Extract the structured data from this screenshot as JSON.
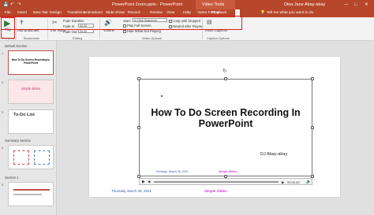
{
  "title_bar": {
    "filename": "PowerPoint Zoom.pptx",
    "app": "PowerPoint",
    "contextual_group": "Video Tools",
    "user": "Dina Jane Abay-abay"
  },
  "tabs": [
    "File",
    "Insert",
    "New Tab",
    "Design",
    "Transitions",
    "Animations",
    "Slide Show",
    "Record",
    "Review",
    "View",
    "Help",
    "Video Format",
    "Playback"
  ],
  "tell_me": "Tell me what you want to do",
  "ribbon": {
    "play_label": "Play",
    "preview_group": "Preview",
    "add_bookmark": "Add Bookmark",
    "remove_bookmark": "Remove Bookmark",
    "bookmarks_group": "Bookmarks",
    "trim_video": "Trim Video",
    "fade_duration": "Fade Duration",
    "fade_in": "Fade In:",
    "fade_in_value": "00.00",
    "fade_out": "Fade Out:",
    "fade_out_value": "00.00",
    "editing_group": "Editing",
    "volume": "Volume",
    "start_label": "Start:",
    "start_value": "In Click Sequence",
    "play_full_screen": "Play Full Screen",
    "hide_not_playing": "Hide While Not Playing",
    "loop": "Loop until Stopped",
    "rewind": "Rewind after Playing",
    "video_options_group": "Video Options",
    "add_caption": "Insert Captions",
    "captions_group": "Captions",
    "caption_options": "Caption Options"
  },
  "pane": {
    "sections": [
      "Default Section",
      "Summary Section",
      "Section 1"
    ],
    "slide_numbers": [
      "1",
      "2",
      "3",
      "4",
      "5"
    ],
    "thumb1_title": "How To Do Screen Recording In PowerPoint",
    "thumb2_title": "simple slides",
    "thumb3_title": "To-Do List"
  },
  "slide": {
    "title": "How To Do Screen Recording In PowerPoint",
    "author": "DJ Abay-abay",
    "inner_date": "Thursday, March 26, 2021",
    "inner_brand": "Simple Slides",
    "footer_date": "Thursday, March 26, 2021",
    "footer_brand": "Simple Slides",
    "time": "00:00.00"
  }
}
